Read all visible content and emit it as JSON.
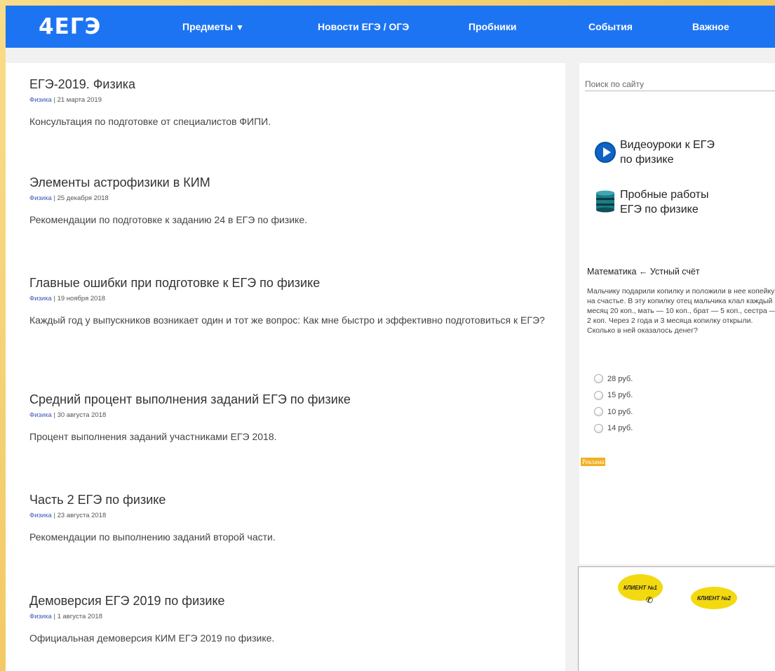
{
  "header": {
    "logo": "4ЕГЭ",
    "nav": [
      {
        "label": "Предметы",
        "caret": "▼"
      },
      {
        "label": "Новости ЕГЭ / ОГЭ"
      },
      {
        "label": "Пробники"
      },
      {
        "label": "События"
      },
      {
        "label": "Важное"
      }
    ]
  },
  "posts": [
    {
      "title": "ЕГЭ-2019. Физика",
      "category": "Физика",
      "date": " | 21 марта 2019",
      "excerpt": "Консультация по подготовке от специалистов ФИПИ."
    },
    {
      "title": "Элементы астрофизики в КИМ",
      "category": "Физика",
      "date": " | 25 декабря 2018",
      "excerpt": "Рекомендации по подготовке к заданию 24 в ЕГЭ по физике."
    },
    {
      "title": "Главные ошибки при подготовке к ЕГЭ по физике",
      "category": "Физика",
      "date": " | 19 ноября 2018",
      "excerpt": "Каждый год у выпускников возникает один и тот же вопрос: Как мне быстро и эффективно подготовиться к ЕГЭ?"
    },
    {
      "title": "Средний процент выполнения заданий ЕГЭ по физике",
      "category": "Физика",
      "date": " | 30 августа 2018",
      "excerpt": "Процент выполнения заданий участниками ЕГЭ 2018."
    },
    {
      "title": "Часть 2 ЕГЭ по физике",
      "category": "Физика",
      "date": " | 23 августа 2018",
      "excerpt": "Рекомендации по выполнению заданий второй части."
    },
    {
      "title": "Демоверсия ЕГЭ 2019 по физике",
      "category": "Физика",
      "date": " | 1 августа 2018",
      "excerpt": "Официальная демоверсия КИМ ЕГЭ 2019 по физике."
    }
  ],
  "sidebar": {
    "search_placeholder": "Поиск по сайту",
    "promo_video": {
      "line1": "Видеоуроки к ЕГЭ",
      "line2": "по физике"
    },
    "promo_tests": {
      "line1": "Пробные работы",
      "line2": "ЕГЭ по физике"
    },
    "quiz": {
      "title": "Математика ← Устный счёт",
      "text": "Мальчику подарили копилку и положили в нее копейку на счастье. В эту копилку отец мальчика клал каждый месяц 20 коп., мать — 10 коп., брат — 5 коп., сестра — 2 коп. Через 2 года и 3 месяца копилку открыли. Сколько в ней оказалось денег?",
      "options": [
        "28 руб.",
        "15 руб.",
        "10 руб.",
        "14 руб."
      ]
    },
    "ad_label": "Реклама"
  },
  "bottom_ad": {
    "client1": "КЛИЕНТ №1",
    "client2": "КЛИЕНТ №2"
  },
  "colors": {
    "header": "#1d74f3",
    "category_link": "#3a5ab7",
    "ad_label": "#f2b021"
  }
}
